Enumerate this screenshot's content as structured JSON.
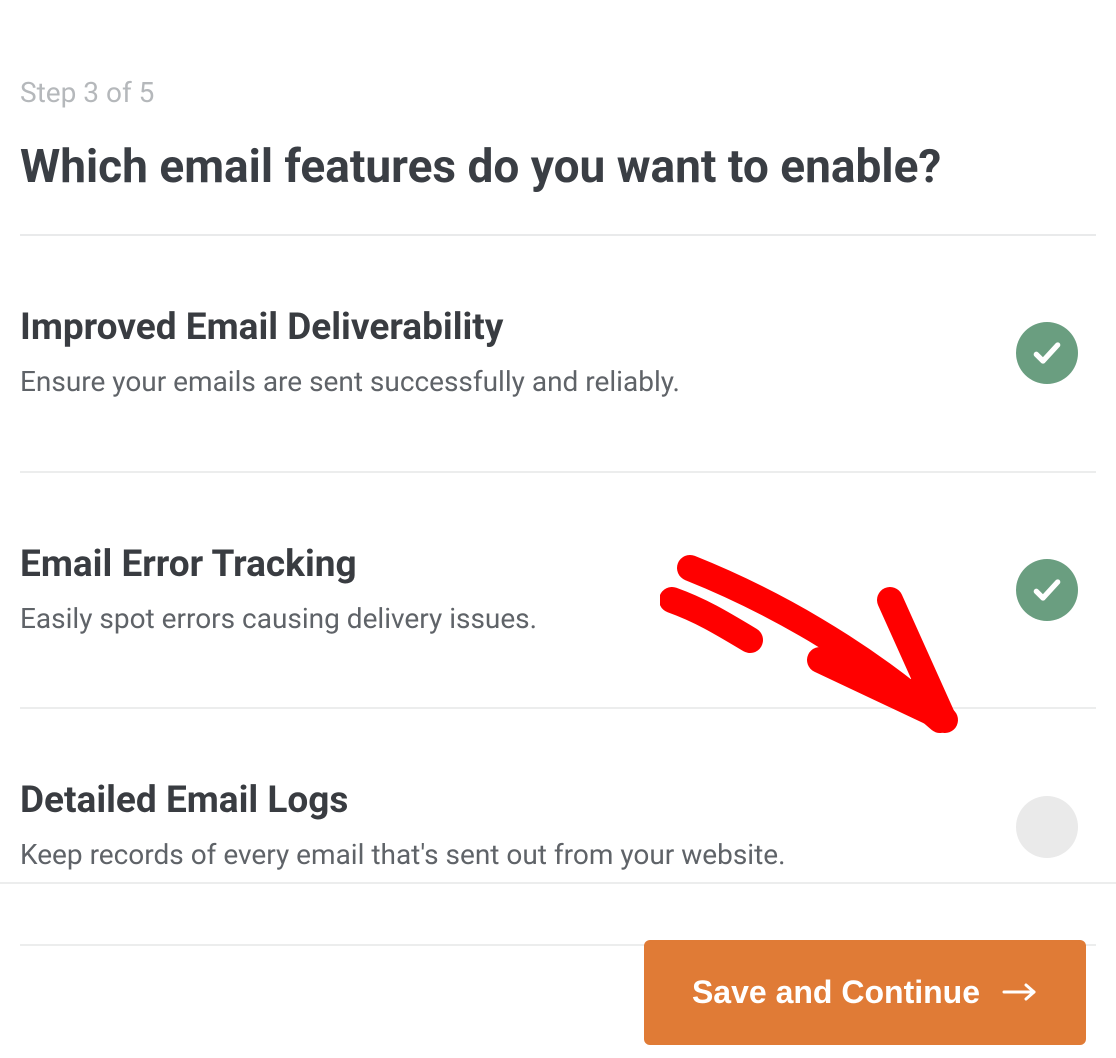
{
  "step_label": "Step 3 of 5",
  "heading": "Which email features do you want to enable?",
  "features": [
    {
      "title": "Improved Email Deliverability",
      "desc": "Ensure your emails are sent successfully and reliably.",
      "enabled": true
    },
    {
      "title": "Email Error Tracking",
      "desc": "Easily spot errors causing delivery issues.",
      "enabled": true
    },
    {
      "title": "Detailed Email Logs",
      "desc": "Keep records of every email that's sent out from your website.",
      "enabled": false
    }
  ],
  "save_button": "Save and Continue",
  "colors": {
    "accent_button": "#e07b36",
    "toggle_on": "#6a9e80",
    "toggle_off": "#eaeaea",
    "annotation": "#ff0000"
  }
}
